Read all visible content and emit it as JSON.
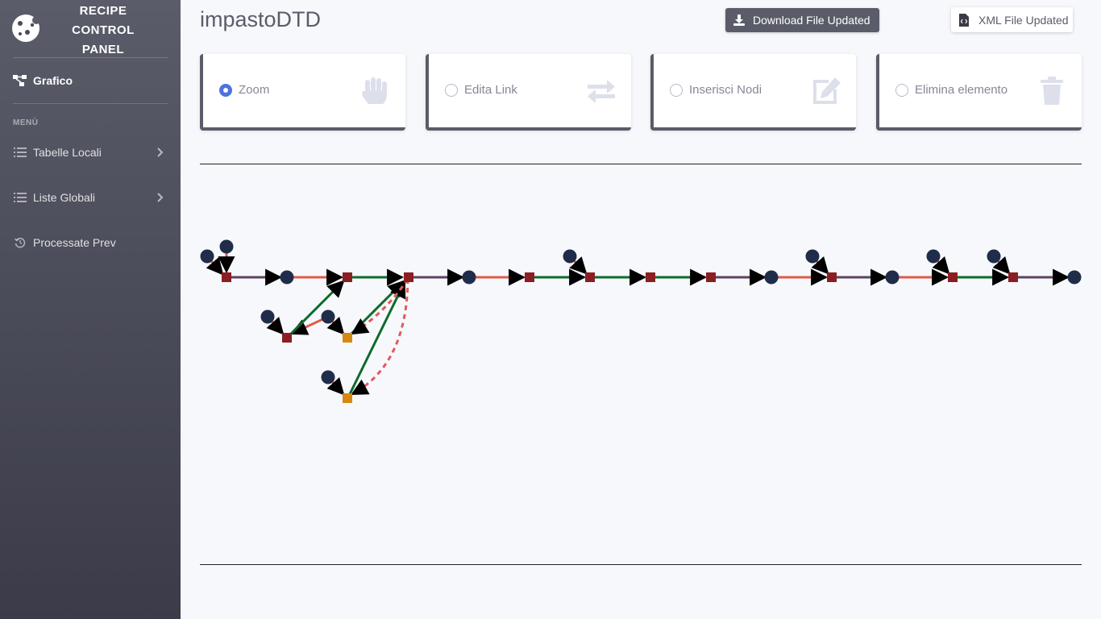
{
  "sidebar": {
    "brand": [
      "RECIPE",
      "CONTROL",
      "PANEL"
    ],
    "grafico": "Grafico",
    "heading": "MENÙ",
    "items": [
      {
        "label": "Tabelle Locali"
      },
      {
        "label": "Liste Globali"
      },
      {
        "label": "Processate Prev"
      }
    ]
  },
  "header": {
    "title": "impastoDTD",
    "download_button": "Download File Updated",
    "xml_button": "XML File Updated"
  },
  "modes": [
    {
      "label": "Zoom",
      "checked": true,
      "icon": "hand-icon"
    },
    {
      "label": "Edita Link",
      "checked": false,
      "icon": "exchange-icon"
    },
    {
      "label": "Inserisci Nodi",
      "checked": false,
      "icon": "edit-icon"
    },
    {
      "label": "Elimina elemento",
      "checked": false,
      "icon": "trash-icon"
    }
  ],
  "colors": {
    "node_circle": "#1f2d4a",
    "node_square": "#8b1e22",
    "node_square_alt": "#d68910",
    "link_orange": "#e05a47",
    "link_green": "#0d6b2a",
    "link_purple": "#5b4560",
    "link_dashed": "#e05a5a"
  }
}
